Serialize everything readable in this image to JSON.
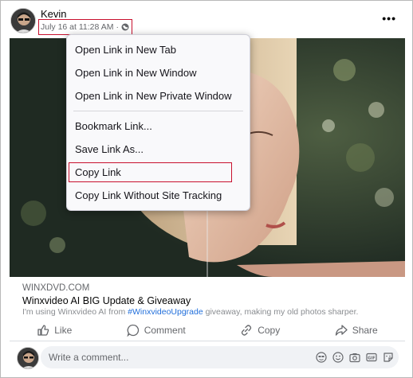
{
  "post": {
    "author": "Kevin",
    "timestamp": "July 16 at 11:28 AM",
    "separator": "·",
    "privacy_icon": "globe-icon",
    "more_label": "•••"
  },
  "context_menu": {
    "items": [
      "Open Link in New Tab",
      "Open Link in New Window",
      "Open Link in New Private Window",
      "Bookmark Link...",
      "Save Link As...",
      "Copy Link",
      "Copy Link Without Site Tracking"
    ]
  },
  "link_preview": {
    "domain": "WINXDVD.COM",
    "title": "Winxvideo AI BIG Update & Giveaway",
    "desc_before": "I'm using Winxvideo AI from ",
    "hashtag": "#WinxvideoUpgrade",
    "desc_after": " giveaway, making my old photos sharper."
  },
  "actions": {
    "like": "Like",
    "comment": "Comment",
    "copy": "Copy",
    "share": "Share"
  },
  "comment_box": {
    "placeholder": "Write a comment...",
    "icons": [
      "avatar-sticker-icon",
      "emoji-icon",
      "camera-icon",
      "gif-icon",
      "sticker-icon"
    ]
  },
  "colors": {
    "highlight_border": "#c8102e",
    "link_blue": "#216fdb",
    "muted_text": "#65676b"
  }
}
